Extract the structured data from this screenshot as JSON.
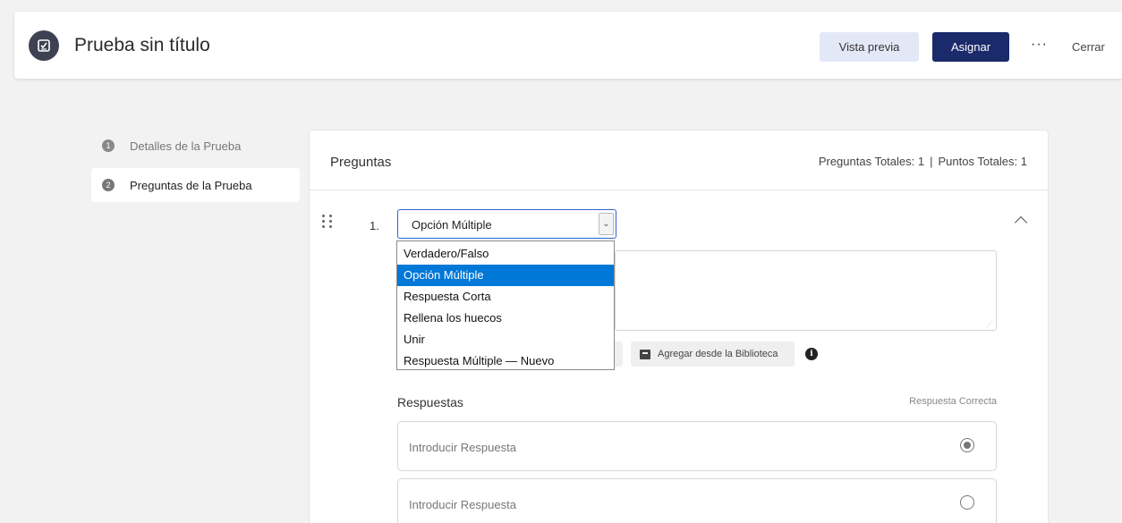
{
  "header": {
    "title": "Prueba sin título",
    "preview_label": "Vista previa",
    "assign_label": "Asignar",
    "more_label": "···",
    "close_label": "Cerrar"
  },
  "steps": [
    {
      "num": "1",
      "label": "Detalles de la Prueba",
      "active": false
    },
    {
      "num": "2",
      "label": "Preguntas de la Prueba",
      "active": true
    }
  ],
  "questions_panel": {
    "title": "Preguntas",
    "total_questions_label": "Preguntas Totales: 1",
    "separator": "|",
    "total_points_label": "Puntos Totales: 1",
    "question": {
      "number": "1.",
      "type_selected": "Opción Múltiple",
      "type_options": [
        "Verdadero/Falso",
        "Opción Múltiple",
        "Respuesta Corta",
        "Rellena los huecos",
        "Unir",
        "Respuesta Múltiple — Nuevo"
      ],
      "selected_index": 1,
      "library_button_label": "Agregar desde la Biblioteca",
      "answers_title": "Respuestas",
      "correct_answer_label": "Respuesta Correcta",
      "answers": [
        {
          "placeholder": "Introducir Respuesta",
          "correct": true
        },
        {
          "placeholder": "Introducir Respuesta",
          "correct": false
        }
      ]
    }
  },
  "colors": {
    "assign_button": "#1a2a6b",
    "preview_button": "#e3e8f7",
    "dropdown_highlight": "#0078d7",
    "select_border": "#2a63d4"
  }
}
